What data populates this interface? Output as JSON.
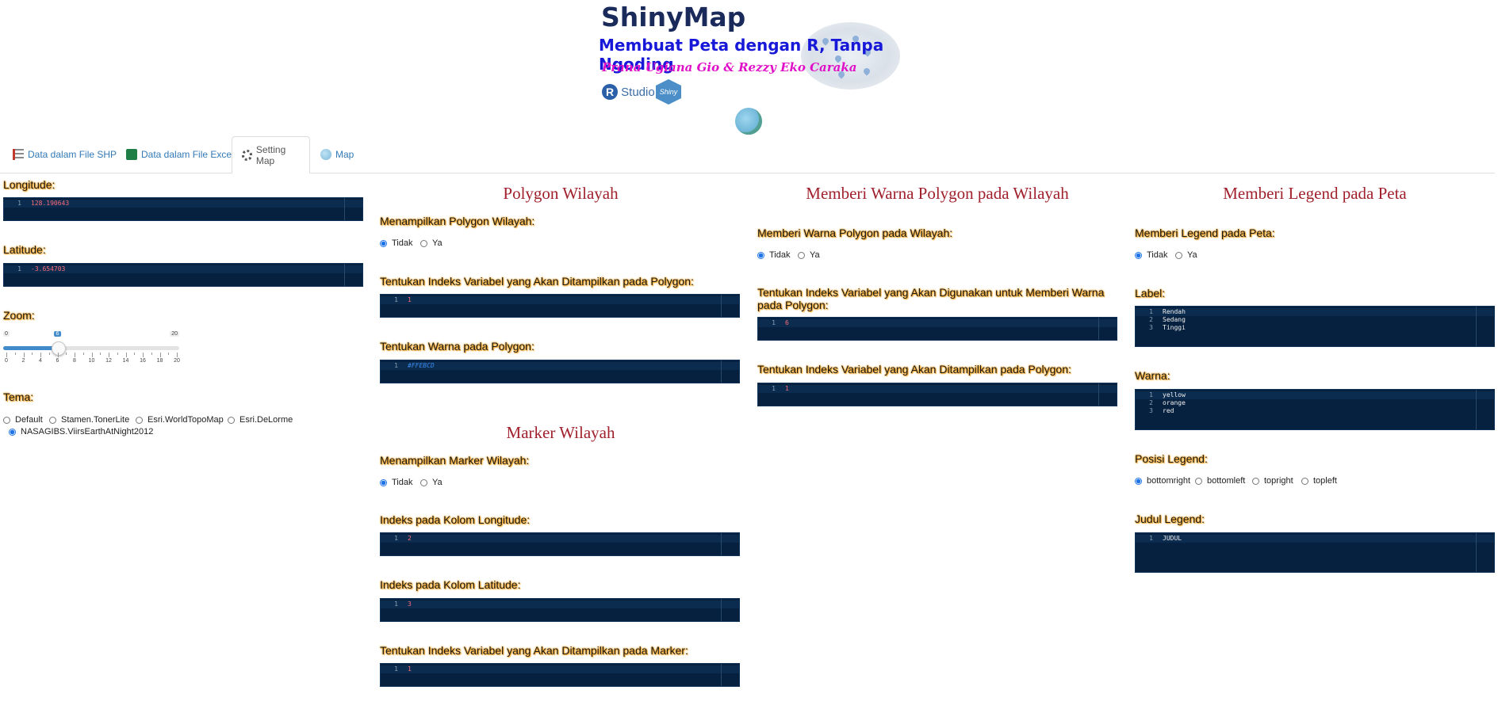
{
  "header": {
    "logo_title": "ShinyMap",
    "logo_subtitle": "Membuat Peta dengan R, Tanpa Ngoding",
    "logo_authors": "Prana Ugiana Gio & Rezzy Eko Caraka",
    "rstudio_text": "Studio",
    "shiny_text": "Shiny"
  },
  "tabs": [
    {
      "label": "Data dalam File SHP",
      "icon": "list-icon"
    },
    {
      "label": "Data dalam File Excel",
      "icon": "excel-icon"
    },
    {
      "label": "Setting Map",
      "icon": "gear-icon"
    },
    {
      "label": "Map",
      "icon": "globe-icon"
    }
  ],
  "active_tab": "Setting Map",
  "col1": {
    "longitude_label": "Longitude:",
    "longitude_value": "128.190643",
    "latitude_label": "Latitude:",
    "latitude_value": "-3.654703",
    "zoom_label": "Zoom:",
    "zoom": {
      "min": 0,
      "max": 20,
      "value": 6,
      "ticks": [
        "0",
        "2",
        "4",
        "6",
        "8",
        "10",
        "12",
        "14",
        "16",
        "18",
        "20"
      ]
    },
    "tema_label": "Tema:",
    "tema_options": [
      "Default",
      "Stamen.TonerLite",
      "Esri.WorldTopoMap",
      "Esri.DeLorme",
      "NASAGIBS.ViirsEarthAtNight2012"
    ],
    "tema_selected": "NASAGIBS.ViirsEarthAtNight2012"
  },
  "col2": {
    "polygon_title": "Polygon Wilayah",
    "show_polygon_label": "Menampilkan Polygon Wilayah:",
    "show_polygon_options": [
      "Tidak",
      "Ya"
    ],
    "show_polygon_selected": "Tidak",
    "polygon_var_label": "Tentukan Indeks Variabel yang Akan Ditampilkan pada Polygon:",
    "polygon_var_value": "1",
    "polygon_color_label": "Tentukan Warna pada Polygon:",
    "polygon_color_value": "#FFEBCD",
    "marker_title": "Marker Wilayah",
    "show_marker_label": "Menampilkan Marker Wilayah:",
    "show_marker_options": [
      "Tidak",
      "Ya"
    ],
    "show_marker_selected": "Tidak",
    "lon_index_label": "Indeks pada Kolom Longitude:",
    "lon_index_value": "2",
    "lat_index_label": "Indeks pada Kolom Latitude:",
    "lat_index_value": "3",
    "marker_var_label": "Tentukan Indeks Variabel yang Akan Ditampilkan pada Marker:",
    "marker_var_value": "1"
  },
  "col3": {
    "title": "Memberi Warna Polygon pada Wilayah",
    "color_polygon_label": "Memberi Warna Polygon pada Wilayah:",
    "color_polygon_options": [
      "Tidak",
      "Ya"
    ],
    "color_polygon_selected": "Tidak",
    "color_var_label_1": "Tentukan Indeks Variabel yang Akan Digunakan untuk Memberi Warna",
    "color_var_label_2": "pada Polygon:",
    "color_var_value": "6",
    "display_var_label": "Tentukan Indeks Variabel yang Akan Ditampilkan pada Polygon:",
    "display_var_value": "1"
  },
  "col4": {
    "title": "Memberi Legend pada Peta",
    "legend_label": "Memberi Legend pada Peta:",
    "legend_options": [
      "Tidak",
      "Ya"
    ],
    "legend_selected": "Tidak",
    "label_label": "Label:",
    "label_lines": [
      "Rendah",
      "Sedang",
      "Tinggi"
    ],
    "warna_label": "Warna:",
    "warna_lines": [
      "yellow",
      "orange",
      "red"
    ],
    "posisi_label": "Posisi Legend:",
    "posisi_options": [
      "bottomright",
      "bottomleft",
      "topright",
      "topleft"
    ],
    "posisi_selected": "bottomright",
    "judul_label": "Judul Legend:",
    "judul_value": "JUDUL"
  },
  "colors": {
    "editor_bg": "#06213f",
    "title_red": "#a0202c",
    "label_glow": "#f5a623",
    "link_blue": "#337ab7"
  }
}
